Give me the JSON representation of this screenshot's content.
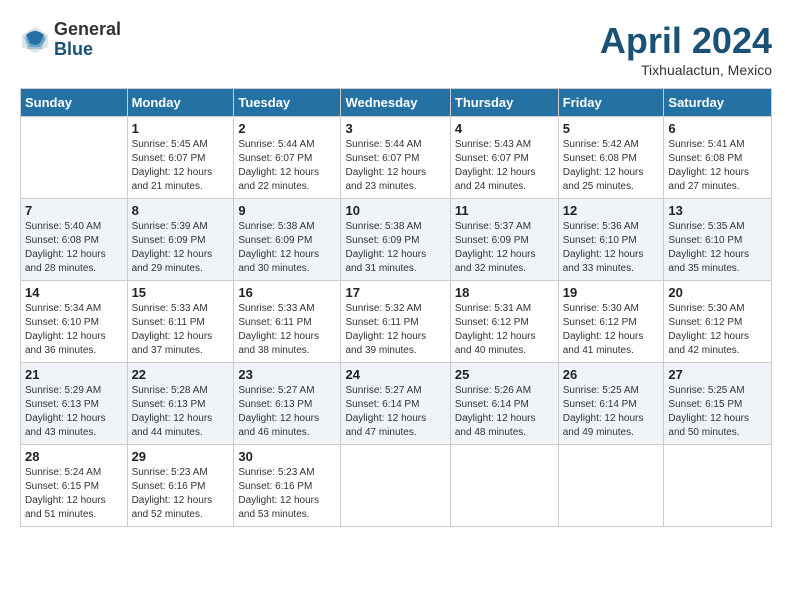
{
  "header": {
    "logo_general": "General",
    "logo_blue": "Blue",
    "month_title": "April 2024",
    "location": "Tixhualactun, Mexico"
  },
  "calendar": {
    "days_of_week": [
      "Sunday",
      "Monday",
      "Tuesday",
      "Wednesday",
      "Thursday",
      "Friday",
      "Saturday"
    ],
    "weeks": [
      [
        {
          "day": "",
          "info": ""
        },
        {
          "day": "1",
          "info": "Sunrise: 5:45 AM\nSunset: 6:07 PM\nDaylight: 12 hours\nand 21 minutes."
        },
        {
          "day": "2",
          "info": "Sunrise: 5:44 AM\nSunset: 6:07 PM\nDaylight: 12 hours\nand 22 minutes."
        },
        {
          "day": "3",
          "info": "Sunrise: 5:44 AM\nSunset: 6:07 PM\nDaylight: 12 hours\nand 23 minutes."
        },
        {
          "day": "4",
          "info": "Sunrise: 5:43 AM\nSunset: 6:07 PM\nDaylight: 12 hours\nand 24 minutes."
        },
        {
          "day": "5",
          "info": "Sunrise: 5:42 AM\nSunset: 6:08 PM\nDaylight: 12 hours\nand 25 minutes."
        },
        {
          "day": "6",
          "info": "Sunrise: 5:41 AM\nSunset: 6:08 PM\nDaylight: 12 hours\nand 27 minutes."
        }
      ],
      [
        {
          "day": "7",
          "info": "Sunrise: 5:40 AM\nSunset: 6:08 PM\nDaylight: 12 hours\nand 28 minutes."
        },
        {
          "day": "8",
          "info": "Sunrise: 5:39 AM\nSunset: 6:09 PM\nDaylight: 12 hours\nand 29 minutes."
        },
        {
          "day": "9",
          "info": "Sunrise: 5:38 AM\nSunset: 6:09 PM\nDaylight: 12 hours\nand 30 minutes."
        },
        {
          "day": "10",
          "info": "Sunrise: 5:38 AM\nSunset: 6:09 PM\nDaylight: 12 hours\nand 31 minutes."
        },
        {
          "day": "11",
          "info": "Sunrise: 5:37 AM\nSunset: 6:09 PM\nDaylight: 12 hours\nand 32 minutes."
        },
        {
          "day": "12",
          "info": "Sunrise: 5:36 AM\nSunset: 6:10 PM\nDaylight: 12 hours\nand 33 minutes."
        },
        {
          "day": "13",
          "info": "Sunrise: 5:35 AM\nSunset: 6:10 PM\nDaylight: 12 hours\nand 35 minutes."
        }
      ],
      [
        {
          "day": "14",
          "info": "Sunrise: 5:34 AM\nSunset: 6:10 PM\nDaylight: 12 hours\nand 36 minutes."
        },
        {
          "day": "15",
          "info": "Sunrise: 5:33 AM\nSunset: 6:11 PM\nDaylight: 12 hours\nand 37 minutes."
        },
        {
          "day": "16",
          "info": "Sunrise: 5:33 AM\nSunset: 6:11 PM\nDaylight: 12 hours\nand 38 minutes."
        },
        {
          "day": "17",
          "info": "Sunrise: 5:32 AM\nSunset: 6:11 PM\nDaylight: 12 hours\nand 39 minutes."
        },
        {
          "day": "18",
          "info": "Sunrise: 5:31 AM\nSunset: 6:12 PM\nDaylight: 12 hours\nand 40 minutes."
        },
        {
          "day": "19",
          "info": "Sunrise: 5:30 AM\nSunset: 6:12 PM\nDaylight: 12 hours\nand 41 minutes."
        },
        {
          "day": "20",
          "info": "Sunrise: 5:30 AM\nSunset: 6:12 PM\nDaylight: 12 hours\nand 42 minutes."
        }
      ],
      [
        {
          "day": "21",
          "info": "Sunrise: 5:29 AM\nSunset: 6:13 PM\nDaylight: 12 hours\nand 43 minutes."
        },
        {
          "day": "22",
          "info": "Sunrise: 5:28 AM\nSunset: 6:13 PM\nDaylight: 12 hours\nand 44 minutes."
        },
        {
          "day": "23",
          "info": "Sunrise: 5:27 AM\nSunset: 6:13 PM\nDaylight: 12 hours\nand 46 minutes."
        },
        {
          "day": "24",
          "info": "Sunrise: 5:27 AM\nSunset: 6:14 PM\nDaylight: 12 hours\nand 47 minutes."
        },
        {
          "day": "25",
          "info": "Sunrise: 5:26 AM\nSunset: 6:14 PM\nDaylight: 12 hours\nand 48 minutes."
        },
        {
          "day": "26",
          "info": "Sunrise: 5:25 AM\nSunset: 6:14 PM\nDaylight: 12 hours\nand 49 minutes."
        },
        {
          "day": "27",
          "info": "Sunrise: 5:25 AM\nSunset: 6:15 PM\nDaylight: 12 hours\nand 50 minutes."
        }
      ],
      [
        {
          "day": "28",
          "info": "Sunrise: 5:24 AM\nSunset: 6:15 PM\nDaylight: 12 hours\nand 51 minutes."
        },
        {
          "day": "29",
          "info": "Sunrise: 5:23 AM\nSunset: 6:16 PM\nDaylight: 12 hours\nand 52 minutes."
        },
        {
          "day": "30",
          "info": "Sunrise: 5:23 AM\nSunset: 6:16 PM\nDaylight: 12 hours\nand 53 minutes."
        },
        {
          "day": "",
          "info": ""
        },
        {
          "day": "",
          "info": ""
        },
        {
          "day": "",
          "info": ""
        },
        {
          "day": "",
          "info": ""
        }
      ]
    ]
  }
}
